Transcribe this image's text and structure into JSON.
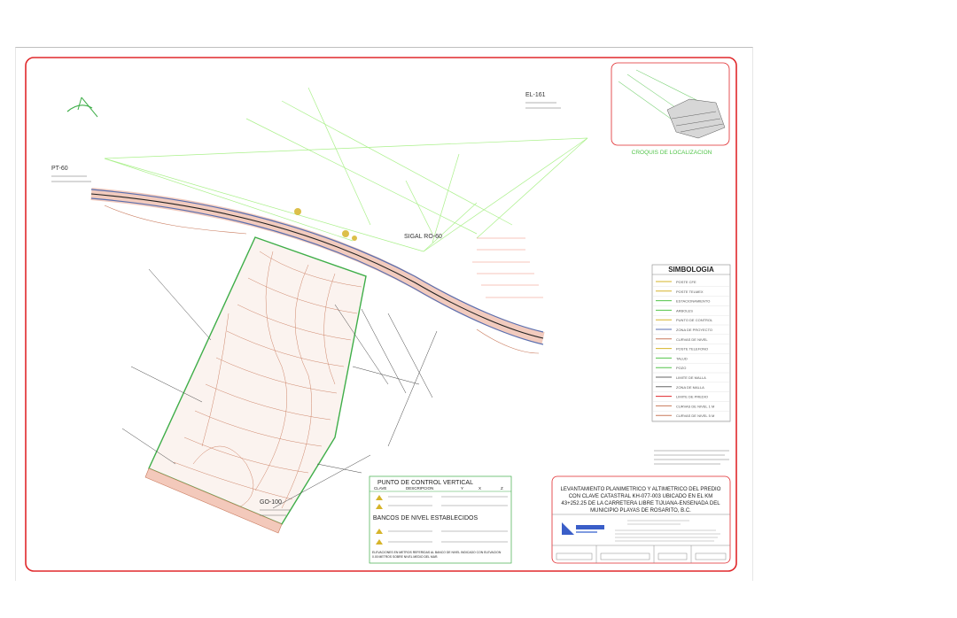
{
  "north_arrow": "N",
  "point_labels": {
    "pt1": "EL-161",
    "pt2": "PT-60",
    "pt3": "GO-100",
    "pt4": "SIGAL RO-60"
  },
  "location_sketch": {
    "caption": "CROQUIS DE LOCALIZACION"
  },
  "legend": {
    "title": "SIMBOLOGIA",
    "items": [
      "POSTE CFE",
      "POSTE TELMEX",
      "ESTACIONAMIENTO",
      "ARBOLES",
      "PUNTO DE CONTROL",
      "ZONA DE PROYECTO",
      "CURVAS DE NIVEL",
      "POSTE TELEFONO",
      "TALUD",
      "POZO",
      "LIMITE DE MALLA",
      "ZONA DE MALLA",
      "LIMITE DE PREDIO",
      "CURVAS DE NIVEL 1 M",
      "CURVAS DE NIVEL 5 M"
    ]
  },
  "control_table": {
    "title": "PUNTO DE CONTROL VERTICAL",
    "headers": [
      "CLAVE",
      "DESCRIPCION",
      "Y",
      "X",
      "Z"
    ],
    "subtitle": "BANCOS DE NIVEL ESTABLECIDOS",
    "footnote_line1": "ELEVACIONES EN METROS REFERIDAS AL BANCO DE NIVEL INDICADO CON ELEVACION",
    "footnote_line2": "0.00 METROS SOBRE NIVEL MEDIO DEL MAR."
  },
  "title_block": {
    "line1": "LEVANTAMIENTO PLANIMETRICO Y ALTIMETRICO DEL PREDIO",
    "line2": "CON CLAVE CATASTRAL KH-077-003 UBICADO EN EL KM",
    "line3": "43+252.25 DE LA CARRETERA LIBRE TIJUANA-ENSENADA DEL",
    "line4": "MUNICIPIO PLAYAS DE ROSARITO, B.C."
  },
  "colors": {
    "frame": "#e0282b",
    "road": "#5a6fb0",
    "contour": "#c8785a",
    "green": "#52c44a",
    "lime": "#aaf08a",
    "yellow": "#d6b42a",
    "dark": "#333333"
  }
}
